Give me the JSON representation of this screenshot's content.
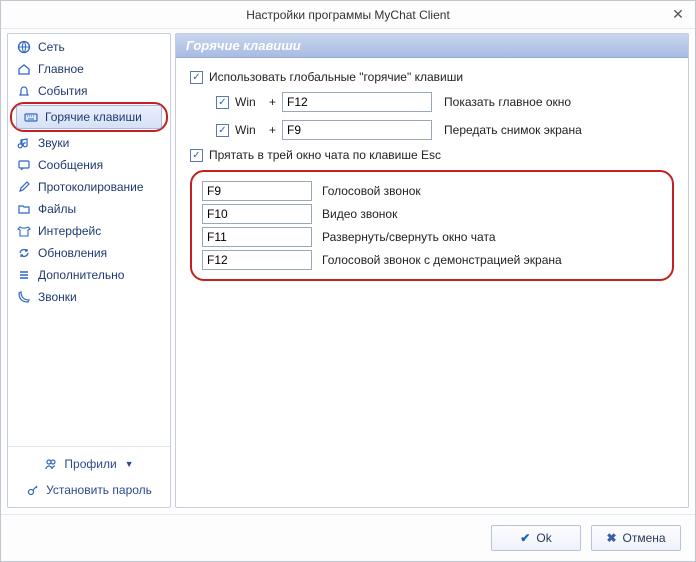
{
  "window": {
    "title": "Настройки программы MyChat Client"
  },
  "sidebar": {
    "items": [
      {
        "label": "Сеть"
      },
      {
        "label": "Главное"
      },
      {
        "label": "События"
      },
      {
        "label": "Горячие клавиши"
      },
      {
        "label": "Звуки"
      },
      {
        "label": "Сообщения"
      },
      {
        "label": "Протоколирование"
      },
      {
        "label": "Файлы"
      },
      {
        "label": "Интерфейс"
      },
      {
        "label": "Обновления"
      },
      {
        "label": "Дополнительно"
      },
      {
        "label": "Звонки"
      }
    ],
    "profiles": "Профили",
    "setPassword": "Установить пароль"
  },
  "panel": {
    "title": "Горячие клавиши",
    "useGlobal": "Использовать глобальные \"горячие\" клавиши",
    "winLabel": "Win",
    "plus": "+",
    "row1": {
      "key": "F12",
      "desc": "Показать главное окно"
    },
    "row2": {
      "key": "F9",
      "desc": "Передать снимок экрана"
    },
    "hideTray": "Прятать в трей окно чата по клавише Esc",
    "hk": [
      {
        "key": "F9",
        "desc": "Голосовой звонок"
      },
      {
        "key": "F10",
        "desc": "Видео звонок"
      },
      {
        "key": "F11",
        "desc": "Развернуть/свернуть окно чата"
      },
      {
        "key": "F12",
        "desc": "Голосовой звонок с демонстрацией экрана"
      }
    ]
  },
  "footer": {
    "ok": "Ok",
    "cancel": "Отмена"
  }
}
